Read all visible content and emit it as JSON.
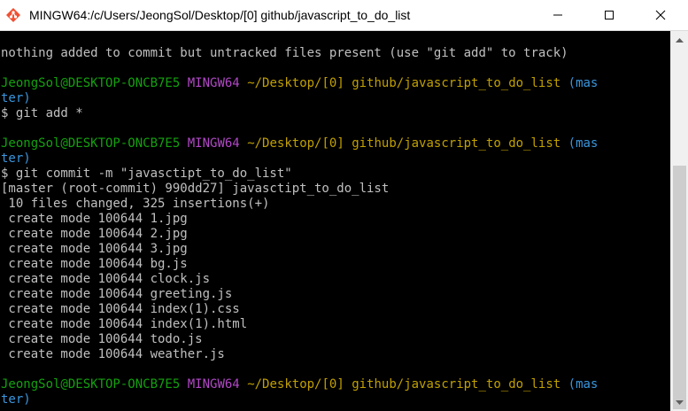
{
  "window": {
    "title": "MINGW64:/c/Users/JeongSol/Desktop/[0] github/javascript_to_do_list",
    "icon": "git-bash-icon",
    "controls": [
      "minimize-icon",
      "maximize-icon",
      "close-icon"
    ]
  },
  "terminal": {
    "colors": {
      "background": "#000000",
      "text": "#c0c0c0",
      "user": "#13a10e",
      "host": "#b148c6",
      "path": "#c1a000",
      "branch": "#3a96dd"
    },
    "lines": [
      {
        "type": "text",
        "text": "nothing added to commit but untracked files present (use \"git add\" to track)"
      },
      {
        "type": "blank"
      },
      {
        "type": "prompt",
        "user": "JeongSol@DESKTOP-ONCB7E5",
        "host": "MINGW64",
        "path": "~/Desktop/[0] github/javascript_to_do_list",
        "branch_start": "(mas"
      },
      {
        "type": "branch_cont",
        "text": "ter)"
      },
      {
        "type": "text",
        "text": "$ git add *"
      },
      {
        "type": "blank"
      },
      {
        "type": "prompt",
        "user": "JeongSol@DESKTOP-ONCB7E5",
        "host": "MINGW64",
        "path": "~/Desktop/[0] github/javascript_to_do_list",
        "branch_start": "(mas"
      },
      {
        "type": "branch_cont",
        "text": "ter)"
      },
      {
        "type": "text",
        "text": "$ git commit -m \"javasctipt_to_do_list\""
      },
      {
        "type": "text",
        "text": "[master (root-commit) 990dd27] javasctipt_to_do_list"
      },
      {
        "type": "text",
        "text": " 10 files changed, 325 insertions(+)"
      },
      {
        "type": "text",
        "text": " create mode 100644 1.jpg"
      },
      {
        "type": "text",
        "text": " create mode 100644 2.jpg"
      },
      {
        "type": "text",
        "text": " create mode 100644 3.jpg"
      },
      {
        "type": "text",
        "text": " create mode 100644 bg.js"
      },
      {
        "type": "text",
        "text": " create mode 100644 clock.js"
      },
      {
        "type": "text",
        "text": " create mode 100644 greeting.js"
      },
      {
        "type": "text",
        "text": " create mode 100644 index(1).css"
      },
      {
        "type": "text",
        "text": " create mode 100644 index(1).html"
      },
      {
        "type": "text",
        "text": " create mode 100644 todo.js"
      },
      {
        "type": "text",
        "text": " create mode 100644 weather.js"
      },
      {
        "type": "blank"
      },
      {
        "type": "prompt",
        "user": "JeongSol@DESKTOP-ONCB7E5",
        "host": "MINGW64",
        "path": "~/Desktop/[0] github/javascript_to_do_list",
        "branch_start": "(mas"
      },
      {
        "type": "branch_cont",
        "text": "ter)"
      }
    ]
  },
  "scrollbar": {
    "icons": [
      "scroll-up-icon",
      "scroll-down-icon"
    ]
  }
}
